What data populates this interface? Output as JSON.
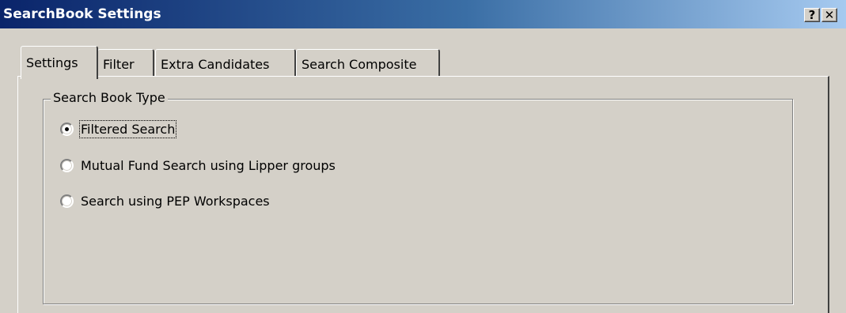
{
  "window": {
    "title": "SearchBook Settings",
    "help_label": "?",
    "close_label": "✕"
  },
  "tabs": [
    {
      "label": "Settings",
      "active": true
    },
    {
      "label": "Filter",
      "active": false
    },
    {
      "label": "Extra Candidates",
      "active": false
    },
    {
      "label": "Search Composite",
      "active": false
    }
  ],
  "search_book_type": {
    "legend": "Search Book Type",
    "options": [
      {
        "label": "Filtered Search",
        "checked": true
      },
      {
        "label": "Mutual Fund Search using Lipper groups",
        "checked": false
      },
      {
        "label": "Search using PEP Workspaces",
        "checked": false
      }
    ]
  },
  "colors": {
    "title_gradient_start": "#0a246a",
    "title_gradient_end": "#a6caf0",
    "face": "#d4d0c8"
  }
}
